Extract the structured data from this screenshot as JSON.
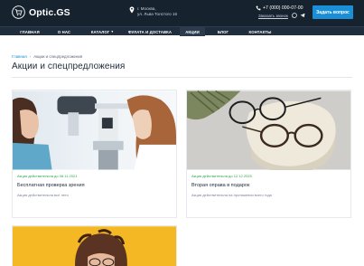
{
  "header": {
    "logo_text": "Optic.GS",
    "location_line1": "г. Москва,",
    "location_line2": "ул. Льва Толстого 16",
    "phone": "+7 (000) 000-07-00",
    "callback": "Заказать звонок",
    "ask_button": "Задать вопрос"
  },
  "nav": {
    "items": [
      {
        "label": "ГЛАВНАЯ"
      },
      {
        "label": "О НАС"
      },
      {
        "label": "КАТАЛОГ"
      },
      {
        "label": "ФУЛАТА И ДОСТАВКА"
      },
      {
        "label": "АКЦИИ"
      },
      {
        "label": "БЛОГ"
      },
      {
        "label": "КОНТАКТЫ"
      }
    ],
    "active": "АКЦИИ"
  },
  "breadcrumb": {
    "home": "Главная",
    "current": "Акции и спецпредложения"
  },
  "page_title": "Акции и спецпредложения",
  "cards": [
    {
      "date": "Акция действительна до 08.11.2021",
      "title": "Бесплатная проверка зрения",
      "desc": "Акция действительна все лето"
    },
    {
      "date": "Акция действительна до 12.12.2025",
      "title": "Вторая оправа в подарок",
      "desc": "Акция действительна на протяжении всего года"
    }
  ],
  "colors": {
    "header_bg": "#17222f",
    "accent": "#1a8fd8",
    "date_green": "#2aa84a"
  }
}
